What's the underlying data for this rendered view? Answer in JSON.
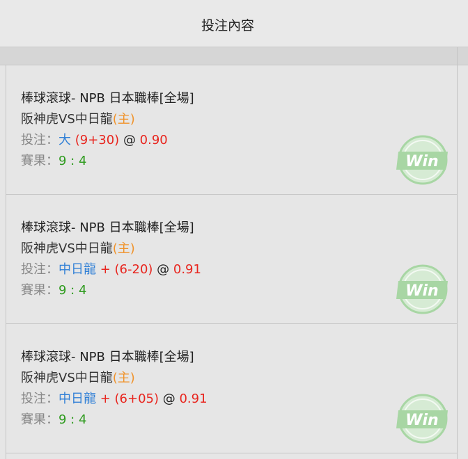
{
  "header": {
    "title": "投注內容"
  },
  "colors": {
    "home_tag": "#f0932b",
    "selection": "#2f7fd6",
    "odds": "#e8251e",
    "score": "#2e9b1e",
    "win_badge": "#a8d6a4"
  },
  "bets": [
    {
      "league": "棒球滾球- NPB 日本職棒[全場]",
      "teams": "阪神虎VS中日龍",
      "home_tag": "(主)",
      "bet_label": "投注：",
      "selection": "大",
      "handicap": " (9+30)",
      "at": " @ ",
      "odds": "0.90",
      "result_label": "賽果：",
      "score": "9 : 4",
      "status": "Win",
      "status_icon": "win-badge-icon"
    },
    {
      "league": "棒球滾球- NPB 日本職棒[全場]",
      "teams": "阪神虎VS中日龍",
      "home_tag": "(主)",
      "bet_label": "投注：",
      "selection": "中日龍",
      "handicap": " + (6-20)",
      "at": " @ ",
      "odds": "0.91",
      "result_label": "賽果：",
      "score": "9 : 4",
      "status": "Win",
      "status_icon": "win-badge-icon"
    },
    {
      "league": "棒球滾球- NPB 日本職棒[全場]",
      "teams": "阪神虎VS中日龍",
      "home_tag": "(主)",
      "bet_label": "投注：",
      "selection": "中日龍",
      "handicap": " + (6+05)",
      "at": " @ ",
      "odds": "0.91",
      "result_label": "賽果：",
      "score": "9 : 4",
      "status": "Win",
      "status_icon": "win-badge-icon"
    }
  ]
}
